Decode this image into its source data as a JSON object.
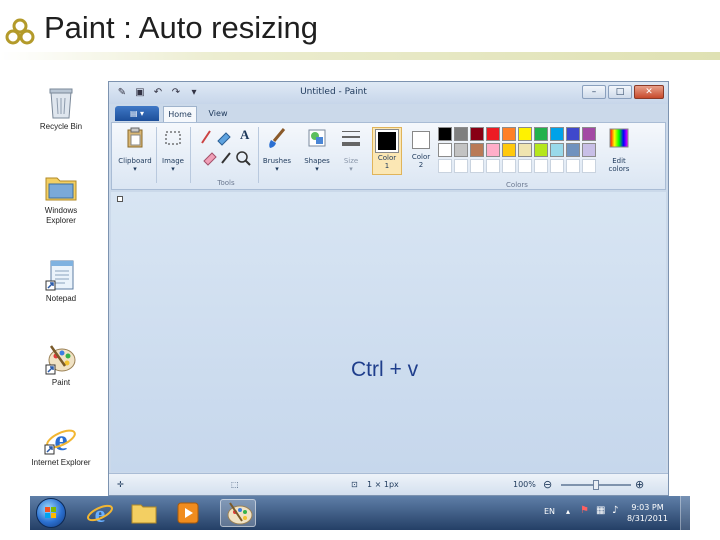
{
  "slide": {
    "title": "Paint : Auto resizing"
  },
  "desktop": {
    "icons": [
      {
        "label": "Recycle Bin"
      },
      {
        "label": "Windows Explorer"
      },
      {
        "label": "Notepad"
      },
      {
        "label": "Paint"
      },
      {
        "label": "Internet Explorer"
      }
    ]
  },
  "window": {
    "title": "Untitled - Paint",
    "tabs": [
      {
        "label": "Home"
      },
      {
        "label": "View"
      }
    ],
    "ribbon": {
      "clipboard": "Clipboard",
      "image": "Image",
      "tools": "Tools",
      "brushes": "Brushes",
      "shapes": "Shapes",
      "size": "Size",
      "color1": {
        "line1": "Color",
        "line2": "1"
      },
      "color2": {
        "line1": "Color",
        "line2": "2"
      },
      "colors": "Colors",
      "edit_colors": {
        "line1": "Edit",
        "line2": "colors"
      },
      "tool_text_icon": "A"
    },
    "canvas": {
      "text": "Ctrl + v"
    },
    "status": {
      "size": "1 × 1px",
      "zoom": "100%"
    },
    "palette": [
      "#000000",
      "#7f7f7f",
      "#880015",
      "#ed1c24",
      "#ff7f27",
      "#fff200",
      "#22b14c",
      "#00a2e8",
      "#3f48cc",
      "#a349a4",
      "#ffffff",
      "#c3c3c3",
      "#b97a57",
      "#ffaec9",
      "#ffc90e",
      "#efe4b0",
      "#b5e61d",
      "#99d9ea",
      "#7092be",
      "#c8bfe7",
      "#ffffff",
      "#ffffff",
      "#ffffff",
      "#ffffff",
      "#ffffff",
      "#ffffff",
      "#ffffff",
      "#ffffff",
      "#ffffff",
      "#ffffff"
    ]
  },
  "taskbar": {
    "lang": "EN",
    "time": "9:03 PM",
    "date": "8/31/2011"
  },
  "colors": {
    "accent": "#1f3e8c",
    "title_rule": "#dfe1b3"
  }
}
